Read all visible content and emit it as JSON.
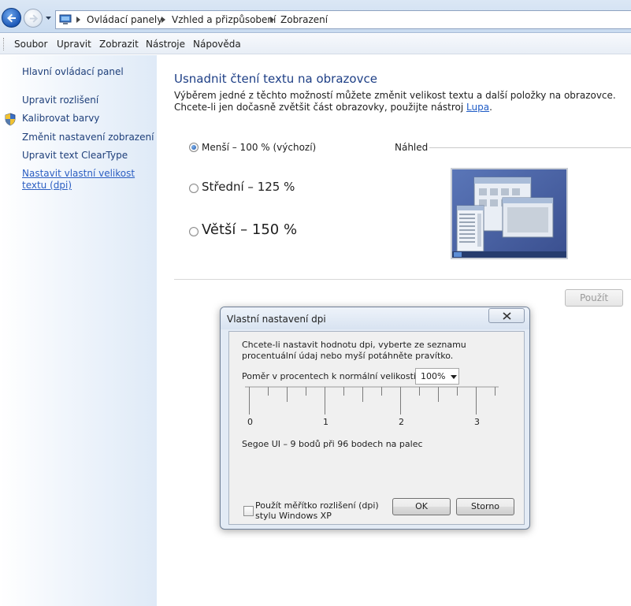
{
  "breadcrumbs": [
    "Ovládací panely",
    "Vzhled a přizpůsobení",
    "Zobrazení"
  ],
  "menu": [
    "Soubor",
    "Upravit",
    "Zobrazit",
    "Nástroje",
    "Nápověda"
  ],
  "sidebar": {
    "home": "Hlavní ovládací panel",
    "items": [
      "Upravit rozlišení",
      "Kalibrovat barvy",
      "Změnit nastavení zobrazení",
      "Upravit text ClearType",
      "Nastavit vlastní velikost textu (dpi)"
    ]
  },
  "main": {
    "title": "Usnadnit čtení textu na obrazovce",
    "description": "Výběrem jedné z těchto možností můžete změnit velikost textu a další položky na obrazovce. Chcete-li jen dočasně zvětšit část obrazovky, použijte nástroj",
    "description_link": "Lupa",
    "description_end": ".",
    "options": [
      {
        "label": "Menší – 100 % (výchozí)",
        "checked": true
      },
      {
        "label": "Střední – 125 %",
        "checked": false
      },
      {
        "label": "Větší – 150 %",
        "checked": false
      }
    ],
    "preview_label": "Náhled",
    "apply_label": "Použít"
  },
  "dialog": {
    "title": "Vlastní nastavení dpi",
    "description": "Chcete-li nastavit hodnotu dpi, vyberte ze seznamu procentuální údaj nebo myší potáhněte pravítko.",
    "ratio_label": "Poměr v procentech k normální velikosti:",
    "ratio_value": "100%",
    "ruler_labels": [
      "0",
      "1",
      "2",
      "3"
    ],
    "font_info": "Segoe UI – 9 bodů při 96 bodech na palec",
    "xp_label": "Použít měřítko rozlišení (dpi) stylu Windows XP",
    "xp_checked": false,
    "ok_label": "OK",
    "cancel_label": "Storno"
  },
  "colors": {
    "link": "#1e3f7a",
    "title_blue": "#1e3f86",
    "active_link": "#2b5ec2"
  }
}
